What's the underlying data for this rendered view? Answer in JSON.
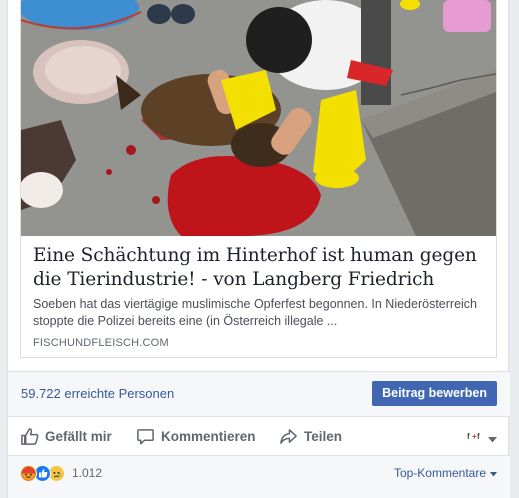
{
  "link_preview": {
    "title": "Eine Schächtung im Hinterhof ist human gegen die Tierindustrie! - von Langberg Friedrich",
    "description": "Soeben hat das viertägige muslimische Opferfest begonnen. In Niederösterreich stoppte die Polizei bereits eine (in Österreich illegale ...",
    "domain": "FISCHUNDFLEISCH.COM"
  },
  "reach": {
    "text": "59.722 erreichte Personen",
    "boost_label": "Beitrag bewerben"
  },
  "actions": {
    "like": "Gefällt mir",
    "comment": "Kommentieren",
    "share": "Teilen"
  },
  "reactions": {
    "icons": [
      "angry-reaction-icon",
      "like-reaction-icon",
      "sad-reaction-icon"
    ],
    "count": "1.012",
    "sort_label": "Top-Kommentare"
  },
  "colors": {
    "link_blue": "#365899",
    "button_blue": "#4267b2",
    "muted_gray": "#606770",
    "background": "#e9ebee"
  }
}
